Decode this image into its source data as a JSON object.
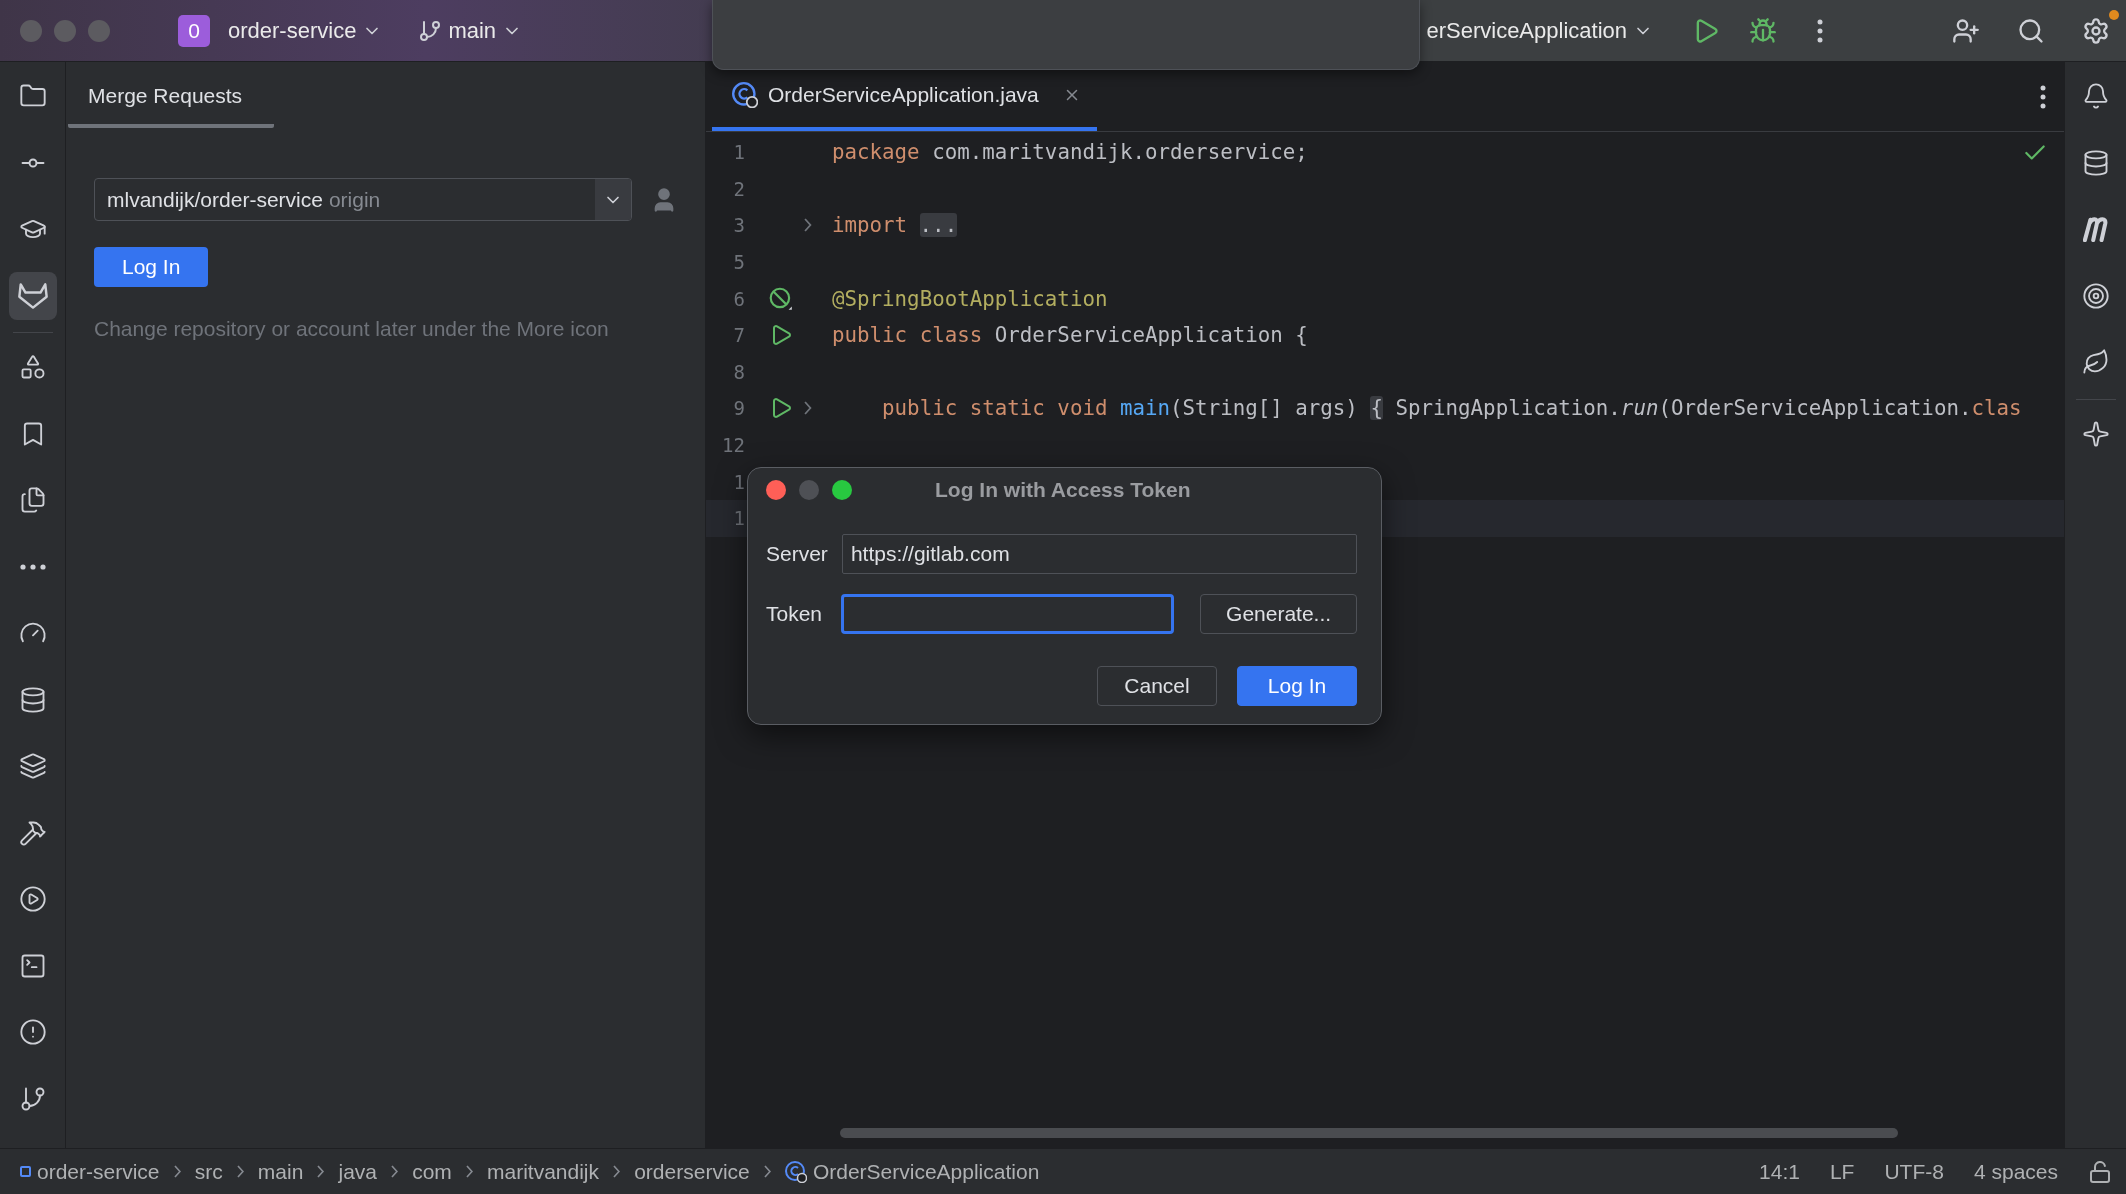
{
  "title_bar": {
    "project_badge": "0",
    "project": "order-service",
    "branch": "main",
    "run_config": "erServiceApplication",
    "settings_notification": true
  },
  "left_toolbar": [
    {
      "kind": "folder",
      "selected": false
    },
    {
      "kind": "commit",
      "selected": false
    },
    {
      "kind": "learn",
      "selected": false
    },
    {
      "kind": "gitlab",
      "selected": true
    },
    {
      "kind": "structure",
      "selected": false
    },
    {
      "kind": "bookmark",
      "selected": false
    },
    {
      "kind": "files",
      "selected": false
    },
    {
      "kind": "more",
      "selected": false
    },
    {
      "kind": "gauge",
      "selected": false
    },
    {
      "kind": "database",
      "selected": false
    },
    {
      "kind": "layers",
      "selected": false
    },
    {
      "kind": "build",
      "selected": false
    },
    {
      "kind": "services",
      "selected": false
    },
    {
      "kind": "terminal",
      "selected": false
    },
    {
      "kind": "problems",
      "selected": false
    },
    {
      "kind": "git",
      "selected": false
    }
  ],
  "tool_window": {
    "title": "Merge Requests",
    "repository": "mlvandijk/order-service",
    "remote": "origin",
    "login_button": "Log In",
    "hint": "Change repository or account later under the More icon"
  },
  "editor": {
    "tab": {
      "label": "OrderServiceApplication.java",
      "selected": true
    },
    "lines": [
      {
        "number": "1",
        "kind": "code",
        "foldable": false,
        "current": false,
        "tokens": [
          {
            "t": "package",
            "kind": "keyword"
          },
          {
            "t": " com.maritvandijk.orderservice;",
            "kind": "plain"
          }
        ]
      },
      {
        "number": "2",
        "kind": "code",
        "foldable": false,
        "current": false
      },
      {
        "number": "3",
        "kind": "code",
        "foldable": true,
        "current": false,
        "tokens": [
          {
            "t": "import",
            "kind": "keyword"
          },
          {
            "t": "...",
            "kind": "fold"
          }
        ]
      },
      {
        "number": "5",
        "kind": "code",
        "foldable": false,
        "current": false
      },
      {
        "number": "6",
        "kind": "bean",
        "foldable": false,
        "current": false,
        "tokens": [
          {
            "t": "@SpringBootApplication",
            "kind": "annotation"
          }
        ]
      },
      {
        "number": "7",
        "kind": "run",
        "foldable": false,
        "current": false,
        "tokens": [
          {
            "t": "public class",
            "kind": "keyword"
          },
          {
            "t": " OrderServiceApplication {",
            "kind": "plain"
          }
        ]
      },
      {
        "number": "8",
        "kind": "code",
        "foldable": false,
        "current": false
      },
      {
        "number": "9",
        "kind": "run",
        "foldable": true,
        "current": false,
        "tokens": [
          {
            "t": "    public static void ",
            "kind": "keyword"
          },
          {
            "t": "main",
            "kind": "method"
          },
          {
            "t": "(String[] args) ",
            "kind": "plain"
          },
          {
            "t": "{",
            "kind": "fold"
          },
          {
            "t": " SpringApplication.",
            "kind": "plain"
          },
          {
            "t": "run",
            "kind": "static"
          },
          {
            "t": "(OrderServiceApplication.",
            "kind": "plain"
          },
          {
            "t": "clas",
            "kind": "keyword"
          }
        ]
      },
      {
        "number": "12",
        "kind": "code",
        "foldable": false,
        "current": false
      },
      {
        "number": "1",
        "kind": "code",
        "current": false
      },
      {
        "number": "1",
        "kind": "code",
        "current": true
      }
    ]
  },
  "dialog": {
    "title": "Log In with Access Token",
    "server_label": "Server",
    "server": "https://gitlab.com",
    "token_label": "Token",
    "token_focused": true,
    "generate": "Generate...",
    "cancel": "Cancel",
    "login": "Log In"
  },
  "status_bar": {
    "breadcrumbs": [
      "order-service",
      "src",
      "main",
      "java",
      "com",
      "maritvandijk",
      "orderservice",
      "OrderServiceApplication"
    ],
    "position": "14:1",
    "line_separator": "LF",
    "encoding": "UTF-8",
    "indent": "4 spaces"
  }
}
